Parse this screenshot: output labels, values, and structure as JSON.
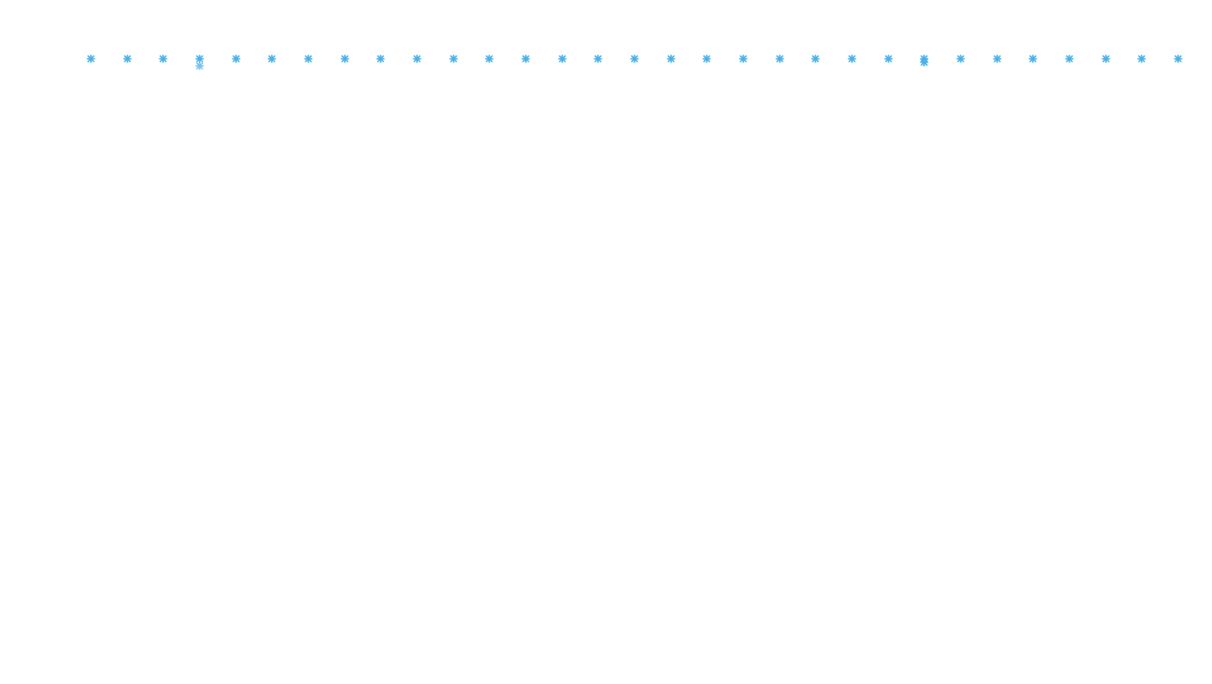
{
  "page": {
    "background": "#ffffff",
    "accent_color": "#4ab0e8"
  },
  "markers": {
    "icon": "asterisk-icon",
    "row_count": 31,
    "extra": [
      {
        "column": 3,
        "kind": "secondary"
      },
      {
        "column": 23,
        "kind": "stacked"
      }
    ]
  }
}
